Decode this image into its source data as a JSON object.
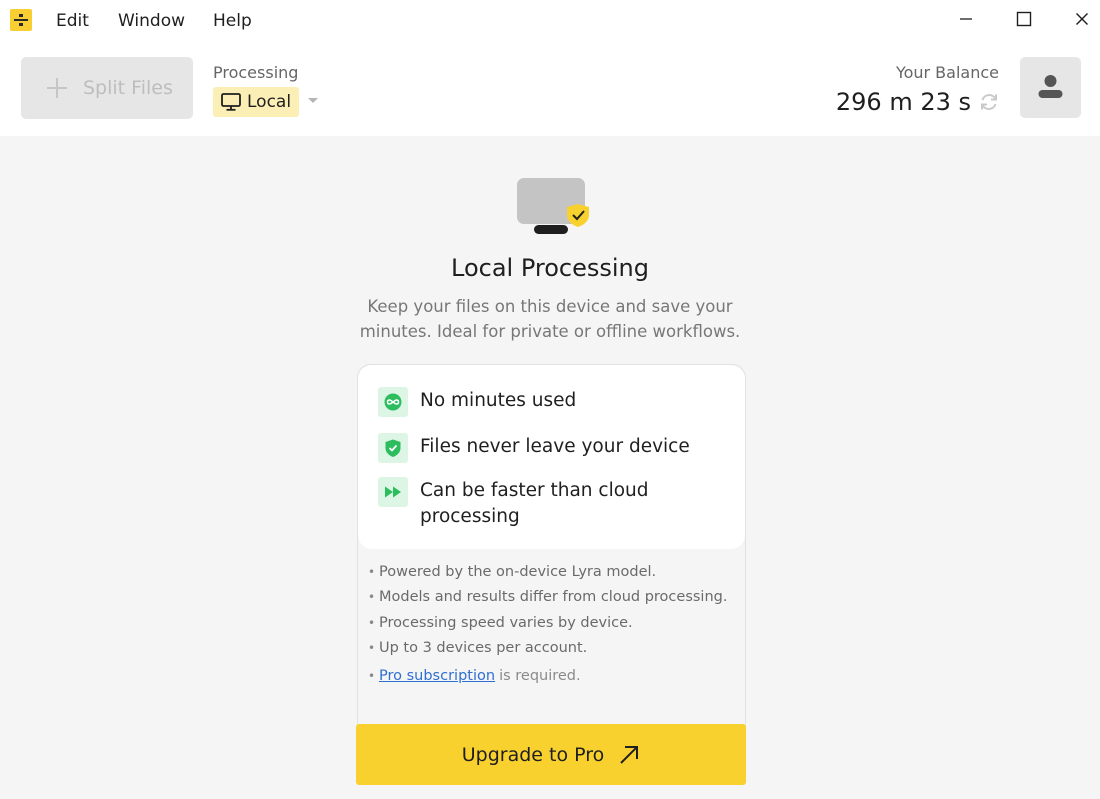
{
  "menu": {
    "edit": "Edit",
    "window": "Window",
    "help": "Help"
  },
  "toolbar": {
    "split_label": "Split Files",
    "processing_label": "Processing",
    "processing_value": "Local",
    "balance_label": "Your Balance",
    "balance_value": "296 m 23 s"
  },
  "main": {
    "title": "Local Processing",
    "description": "Keep your files on this device and save your minutes. Ideal for private or offline workflows.",
    "features": [
      {
        "icon": "infinity-icon",
        "text": "No minutes used"
      },
      {
        "icon": "shield-check-icon",
        "text": "Files never leave your device"
      },
      {
        "icon": "fast-forward-icon",
        "text": "Can be faster than cloud processing"
      }
    ],
    "notes": [
      "Powered by the on-device Lyra model.",
      "Models and results differ from cloud processing.",
      "Processing speed varies by device.",
      "Up to 3 devices per account."
    ],
    "pro_link": "Pro subscription",
    "pro_suffix": "is required.",
    "upgrade_label": "Upgrade to Pro"
  },
  "colors": {
    "accent": "#f9d12f",
    "select_bg": "#fbefb5",
    "feature_icon_bg": "#dcf5e4",
    "feature_icon": "#2dbd5f",
    "link": "#2f6fd1"
  }
}
